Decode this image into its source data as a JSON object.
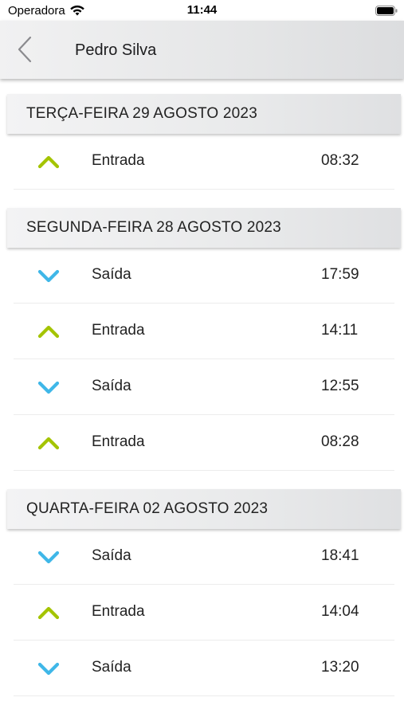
{
  "status_bar": {
    "carrier": "Operadora",
    "time": "11:44"
  },
  "header": {
    "title": "Pedro Silva",
    "back_icon": "chevron-left-icon"
  },
  "colors": {
    "entrada_icon": "#a4c400",
    "saida_icon": "#3fb7e8"
  },
  "sections": [
    {
      "date": "TERÇA-FEIRA 29 AGOSTO 2023",
      "entries": [
        {
          "type": "entrada",
          "icon": "chevron-up-icon",
          "label": "Entrada",
          "time": "08:32"
        }
      ]
    },
    {
      "date": "SEGUNDA-FEIRA 28 AGOSTO 2023",
      "entries": [
        {
          "type": "saida",
          "icon": "chevron-down-icon",
          "label": "Saída",
          "time": "17:59"
        },
        {
          "type": "entrada",
          "icon": "chevron-up-icon",
          "label": "Entrada",
          "time": "14:11"
        },
        {
          "type": "saida",
          "icon": "chevron-down-icon",
          "label": "Saída",
          "time": "12:55"
        },
        {
          "type": "entrada",
          "icon": "chevron-up-icon",
          "label": "Entrada",
          "time": "08:28"
        }
      ]
    },
    {
      "date": "QUARTA-FEIRA 02 AGOSTO 2023",
      "entries": [
        {
          "type": "saida",
          "icon": "chevron-down-icon",
          "label": "Saída",
          "time": "18:41"
        },
        {
          "type": "entrada",
          "icon": "chevron-up-icon",
          "label": "Entrada",
          "time": "14:04"
        },
        {
          "type": "saida",
          "icon": "chevron-down-icon",
          "label": "Saída",
          "time": "13:20"
        }
      ]
    }
  ]
}
